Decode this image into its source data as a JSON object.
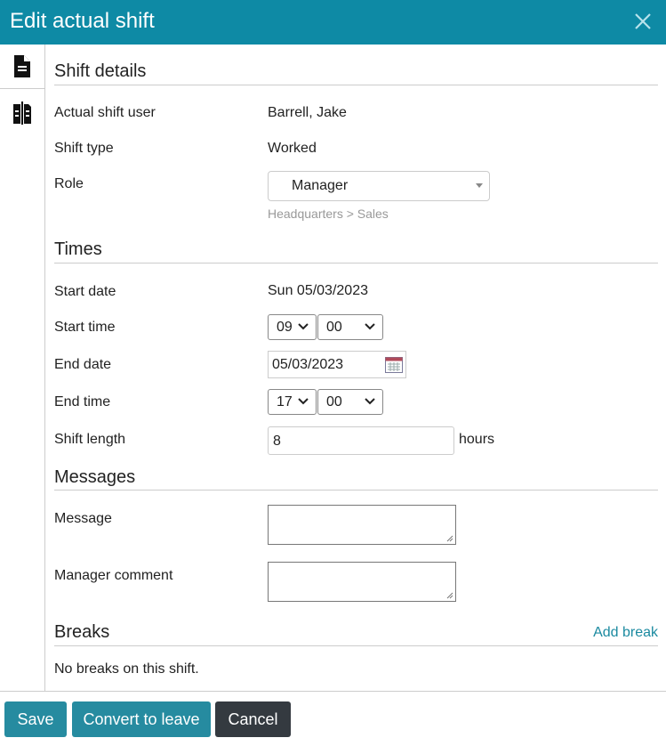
{
  "dialog": {
    "title": "Edit actual shift"
  },
  "sections": {
    "shift_details": "Shift details",
    "times": "Times",
    "messages": "Messages",
    "breaks": "Breaks"
  },
  "fields": {
    "shift_user_label": "Actual shift user",
    "shift_user_value": "Barrell, Jake",
    "shift_type_label": "Shift type",
    "shift_type_value": "Worked",
    "role_label": "Role",
    "role_value": "Manager",
    "role_hint": "Headquarters > Sales",
    "start_date_label": "Start date",
    "start_date_value": "Sun 05/03/2023",
    "start_time_label": "Start time",
    "start_hour": "09",
    "start_min": "00",
    "end_date_label": "End date",
    "end_date_value": "05/03/2023",
    "end_time_label": "End time",
    "end_hour": "17",
    "end_min": "00",
    "shift_length_label": "Shift length",
    "shift_length_value": "8",
    "shift_length_unit": "hours",
    "message_label": "Message",
    "manager_comment_label": "Manager comment"
  },
  "breaks": {
    "add_link": "Add break",
    "empty_text": "No breaks on this shift."
  },
  "footer": {
    "save": "Save",
    "convert": "Convert to leave",
    "cancel": "Cancel"
  },
  "colors": {
    "header": "#0e8aa5",
    "primary_button": "#268ba0",
    "cancel_button": "#343a40",
    "link": "#1b8aa0"
  }
}
